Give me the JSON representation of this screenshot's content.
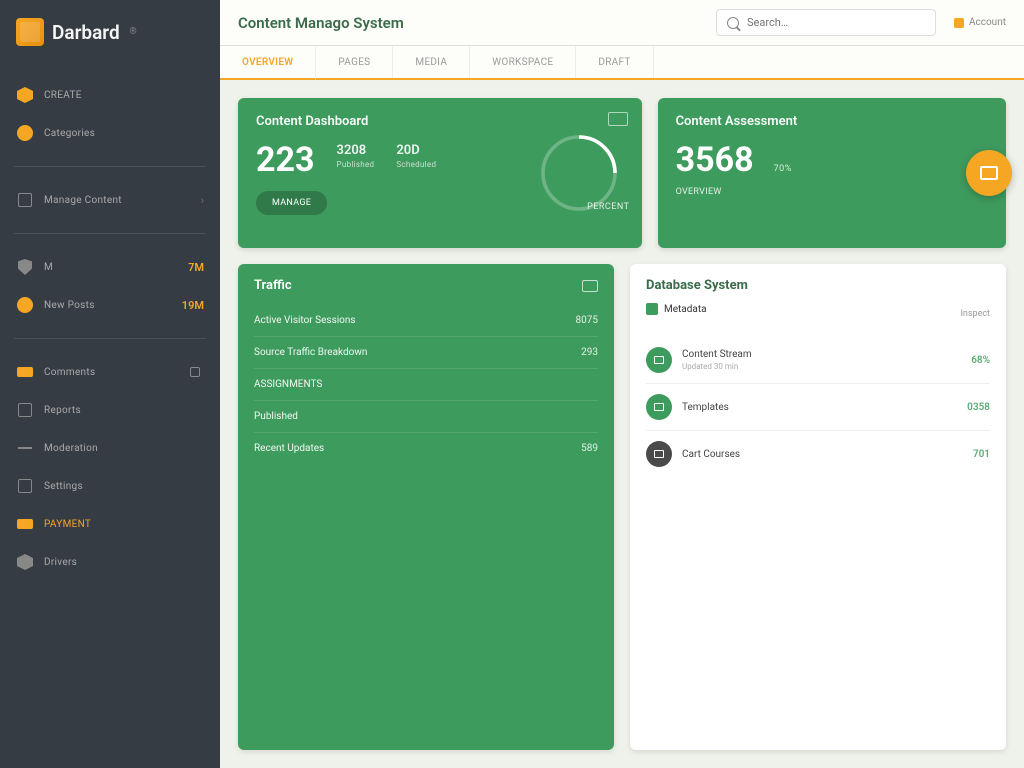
{
  "brand": {
    "name": "Darbard",
    "trademark": "®"
  },
  "sidebar": {
    "group1": [
      {
        "label": "CREATE",
        "badge": ""
      },
      {
        "label": "Categories",
        "badge": ""
      }
    ],
    "group2": [
      {
        "label": "Manage Content",
        "badge": ""
      }
    ],
    "group3": [
      {
        "label": "M",
        "badge": "7M"
      },
      {
        "label": "New Posts",
        "badge": "19M"
      }
    ],
    "group4": [
      {
        "label": "Comments"
      },
      {
        "label": "Reports"
      },
      {
        "label": "Moderation"
      },
      {
        "label": "Settings"
      },
      {
        "label": "PAYMENT"
      },
      {
        "label": "Drivers"
      }
    ]
  },
  "header": {
    "title": "Content Manago System",
    "search_placeholder": "Search…",
    "toplink": "Account"
  },
  "tabs": [
    "OVERVIEW",
    "PAGES",
    "MEDIA",
    "WORKSPACE",
    "DRAFT"
  ],
  "card1": {
    "title": "Content Dashboard",
    "big": "223",
    "s1": {
      "v": "3208",
      "l": "Published"
    },
    "s2": {
      "v": "20D",
      "l": "Scheduled"
    },
    "btn": "MANAGE",
    "gauge": "PERCENT"
  },
  "card2": {
    "title": "Content Assessment",
    "big": "3568",
    "s1": {
      "v": "70%",
      "l": ""
    },
    "link": "OVERVIEW"
  },
  "panelL": {
    "title": "Traffic",
    "rows": [
      {
        "l": "Active Visitor Sessions",
        "v": "8075"
      },
      {
        "l": "Source Traffic Breakdown",
        "v": "293"
      },
      {
        "l": "ASSIGNMENTS",
        "v": ""
      },
      {
        "l": "Published",
        "v": ""
      },
      {
        "l": "Recent Updates",
        "v": "589"
      }
    ]
  },
  "panelR": {
    "title": "Database System",
    "sub": "Metadata",
    "link": "Inspect",
    "rows": [
      {
        "l": "Content Stream",
        "s": "Updated 30 min",
        "v": "68%"
      },
      {
        "l": "Templates",
        "s": "",
        "v": "0358"
      },
      {
        "l": "Cart Courses",
        "s": "",
        "v": "701"
      }
    ]
  }
}
